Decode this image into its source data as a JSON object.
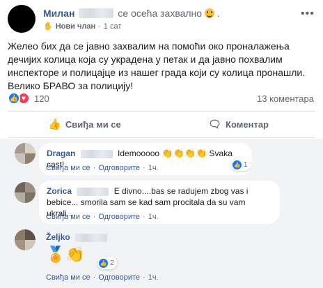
{
  "post": {
    "author": "Милан",
    "feeling_text": "се осећа захвално",
    "badge": "Нови члан",
    "time": "1 сат",
    "text": "Желео бих да се јавно захвалим на помоћи око проналажења дечијих колица која су украдена у петак и да јавно похвалим инспекторе и полицајце из нашег града који су колица пронашли. Велико БРАВО за полицију!",
    "reactions_count": "120",
    "comments_count": "13 коментара",
    "actions": {
      "like": "Свиђа ми се",
      "comment": "Коментар"
    }
  },
  "comments": [
    {
      "name": "Dragan",
      "text_before": "Idemooooo",
      "text_after": "Svaka cast!",
      "like_label": "Свиђа ми се",
      "reply_label": "Одговорите",
      "time": "1ч.",
      "reaction_count": "1"
    },
    {
      "name": "Zorica",
      "text": "E divno....bas se radujem zbog vas i bebice... smorila sam se kad sam procitala da su vam ukrali...",
      "like_label": "Свиђа ми се",
      "reply_label": "Одговорите",
      "time": "1ч."
    },
    {
      "name": "Željko",
      "like_label": "Свиђа ми се",
      "reply_label": "Одговорите",
      "time": "1ч.",
      "reaction_count": "2"
    }
  ],
  "icons": {
    "more": "more-icon",
    "new_member": "wave-icon",
    "like_reaction": "like-reaction-icon",
    "love_reaction": "love-reaction-icon",
    "clap": "clapping-hands-icon",
    "medal": "medal-icon"
  },
  "colors": {
    "link": "#385898",
    "like_blue": "#1877f2",
    "love_red": "#f33e58",
    "comment_bg": "#f2f3f5"
  }
}
